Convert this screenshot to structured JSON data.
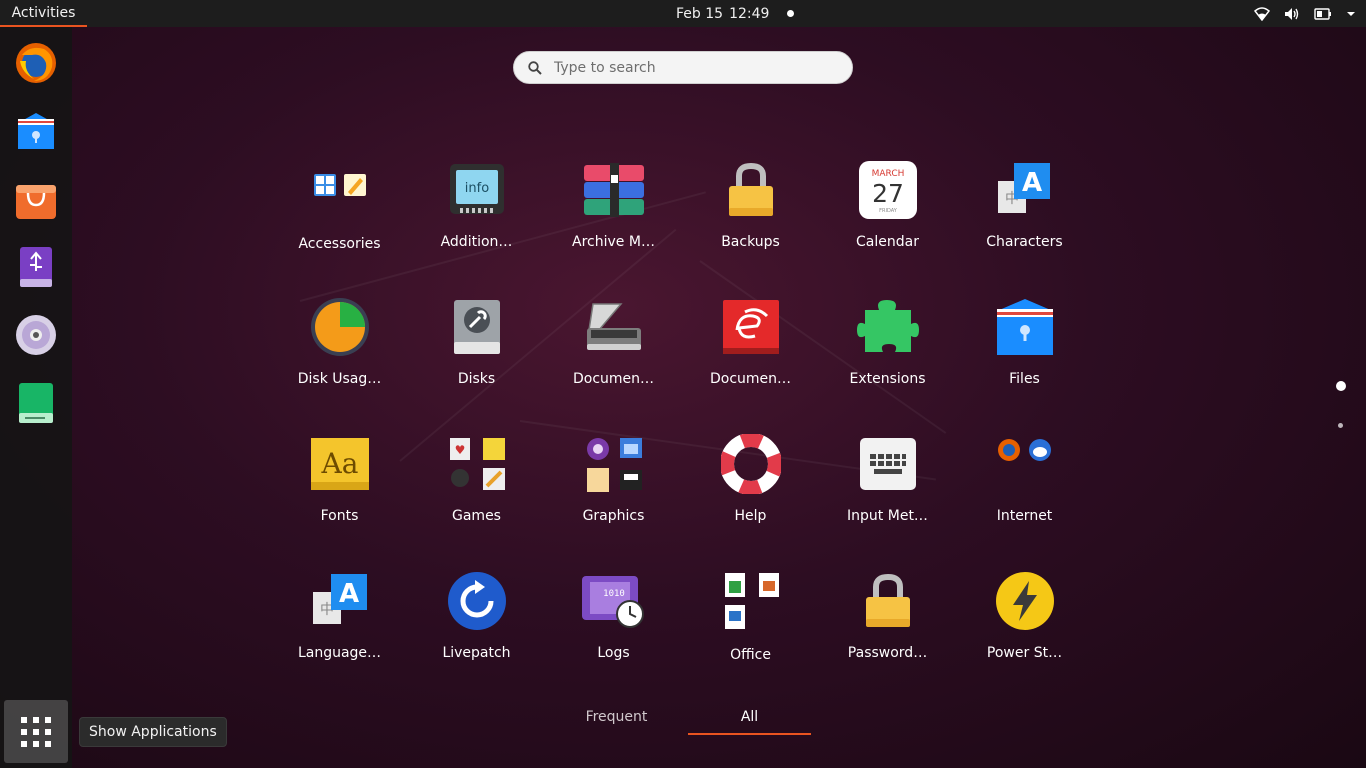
{
  "topbar": {
    "activities": "Activities",
    "date": "Feb 15",
    "time": "12:49"
  },
  "dock": {
    "items": [
      {
        "name": "firefox",
        "icon": "firefox-icon"
      },
      {
        "name": "files",
        "icon": "files-icon"
      },
      {
        "name": "software",
        "icon": "shopping-bag-icon"
      },
      {
        "name": "usb-creator",
        "icon": "usb-drive-icon"
      },
      {
        "name": "disc",
        "icon": "cd-disc-icon"
      },
      {
        "name": "drive",
        "icon": "green-drive-icon"
      }
    ],
    "show_apps_tooltip": "Show Applications"
  },
  "search": {
    "placeholder": "Type to search"
  },
  "apps": [
    {
      "label": "Accessories",
      "icon": "accessories-folder-icon"
    },
    {
      "label": "Addition…",
      "icon": "additional-drivers-icon"
    },
    {
      "label": "Archive M…",
      "icon": "archive-manager-icon"
    },
    {
      "label": "Backups",
      "icon": "backups-lock-icon"
    },
    {
      "label": "Calendar",
      "icon": "calendar-icon",
      "month": "MARCH",
      "day": "27",
      "weekday": "FRIDAY"
    },
    {
      "label": "Characters",
      "icon": "characters-icon"
    },
    {
      "label": "Disk Usag…",
      "icon": "disk-usage-icon"
    },
    {
      "label": "Disks",
      "icon": "disks-icon"
    },
    {
      "label": "Documen…",
      "icon": "document-scanner-icon"
    },
    {
      "label": "Documen…",
      "icon": "document-viewer-icon"
    },
    {
      "label": "Extensions",
      "icon": "puzzle-icon"
    },
    {
      "label": "Files",
      "icon": "files-icon"
    },
    {
      "label": "Fonts",
      "icon": "fonts-icon"
    },
    {
      "label": "Games",
      "icon": "games-folder-icon"
    },
    {
      "label": "Graphics",
      "icon": "graphics-folder-icon"
    },
    {
      "label": "Help",
      "icon": "lifebuoy-icon"
    },
    {
      "label": "Input Met…",
      "icon": "keyboard-icon"
    },
    {
      "label": "Internet",
      "icon": "internet-folder-icon"
    },
    {
      "label": "Language…",
      "icon": "language-icon"
    },
    {
      "label": "Livepatch",
      "icon": "livepatch-icon"
    },
    {
      "label": "Logs",
      "icon": "logs-icon"
    },
    {
      "label": "Office",
      "icon": "office-folder-icon"
    },
    {
      "label": "Password…",
      "icon": "password-lock-icon"
    },
    {
      "label": "Power St…",
      "icon": "power-bolt-icon"
    }
  ],
  "tabs": {
    "frequent": "Frequent",
    "all": "All",
    "active": "All"
  },
  "colors": {
    "accent": "#e95420",
    "topbar": "#1d1d1d"
  }
}
